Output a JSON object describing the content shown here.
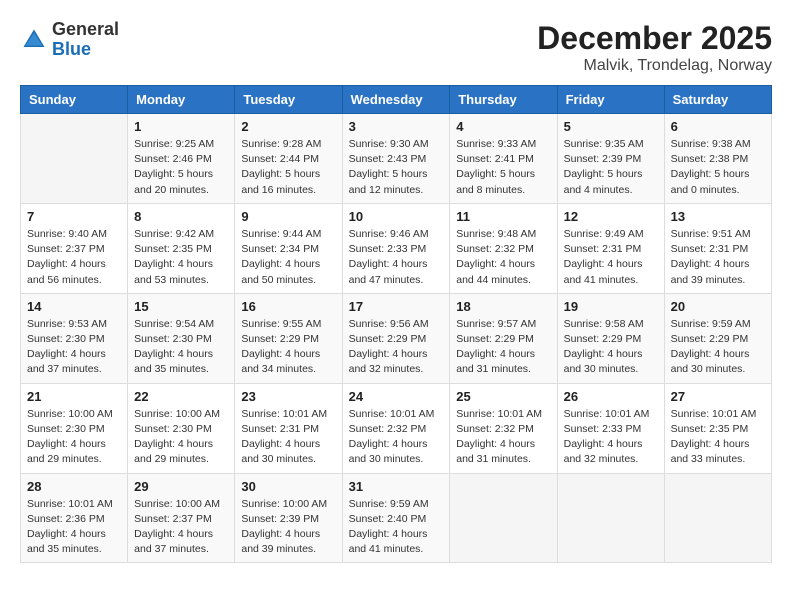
{
  "header": {
    "logo_general": "General",
    "logo_blue": "Blue",
    "month_year": "December 2025",
    "location": "Malvik, Trondelag, Norway"
  },
  "days_of_week": [
    "Sunday",
    "Monday",
    "Tuesday",
    "Wednesday",
    "Thursday",
    "Friday",
    "Saturday"
  ],
  "weeks": [
    [
      {
        "day": "",
        "info": ""
      },
      {
        "day": "1",
        "info": "Sunrise: 9:25 AM\nSunset: 2:46 PM\nDaylight: 5 hours\nand 20 minutes."
      },
      {
        "day": "2",
        "info": "Sunrise: 9:28 AM\nSunset: 2:44 PM\nDaylight: 5 hours\nand 16 minutes."
      },
      {
        "day": "3",
        "info": "Sunrise: 9:30 AM\nSunset: 2:43 PM\nDaylight: 5 hours\nand 12 minutes."
      },
      {
        "day": "4",
        "info": "Sunrise: 9:33 AM\nSunset: 2:41 PM\nDaylight: 5 hours\nand 8 minutes."
      },
      {
        "day": "5",
        "info": "Sunrise: 9:35 AM\nSunset: 2:39 PM\nDaylight: 5 hours\nand 4 minutes."
      },
      {
        "day": "6",
        "info": "Sunrise: 9:38 AM\nSunset: 2:38 PM\nDaylight: 5 hours\nand 0 minutes."
      }
    ],
    [
      {
        "day": "7",
        "info": "Sunrise: 9:40 AM\nSunset: 2:37 PM\nDaylight: 4 hours\nand 56 minutes."
      },
      {
        "day": "8",
        "info": "Sunrise: 9:42 AM\nSunset: 2:35 PM\nDaylight: 4 hours\nand 53 minutes."
      },
      {
        "day": "9",
        "info": "Sunrise: 9:44 AM\nSunset: 2:34 PM\nDaylight: 4 hours\nand 50 minutes."
      },
      {
        "day": "10",
        "info": "Sunrise: 9:46 AM\nSunset: 2:33 PM\nDaylight: 4 hours\nand 47 minutes."
      },
      {
        "day": "11",
        "info": "Sunrise: 9:48 AM\nSunset: 2:32 PM\nDaylight: 4 hours\nand 44 minutes."
      },
      {
        "day": "12",
        "info": "Sunrise: 9:49 AM\nSunset: 2:31 PM\nDaylight: 4 hours\nand 41 minutes."
      },
      {
        "day": "13",
        "info": "Sunrise: 9:51 AM\nSunset: 2:31 PM\nDaylight: 4 hours\nand 39 minutes."
      }
    ],
    [
      {
        "day": "14",
        "info": "Sunrise: 9:53 AM\nSunset: 2:30 PM\nDaylight: 4 hours\nand 37 minutes."
      },
      {
        "day": "15",
        "info": "Sunrise: 9:54 AM\nSunset: 2:30 PM\nDaylight: 4 hours\nand 35 minutes."
      },
      {
        "day": "16",
        "info": "Sunrise: 9:55 AM\nSunset: 2:29 PM\nDaylight: 4 hours\nand 34 minutes."
      },
      {
        "day": "17",
        "info": "Sunrise: 9:56 AM\nSunset: 2:29 PM\nDaylight: 4 hours\nand 32 minutes."
      },
      {
        "day": "18",
        "info": "Sunrise: 9:57 AM\nSunset: 2:29 PM\nDaylight: 4 hours\nand 31 minutes."
      },
      {
        "day": "19",
        "info": "Sunrise: 9:58 AM\nSunset: 2:29 PM\nDaylight: 4 hours\nand 30 minutes."
      },
      {
        "day": "20",
        "info": "Sunrise: 9:59 AM\nSunset: 2:29 PM\nDaylight: 4 hours\nand 30 minutes."
      }
    ],
    [
      {
        "day": "21",
        "info": "Sunrise: 10:00 AM\nSunset: 2:30 PM\nDaylight: 4 hours\nand 29 minutes."
      },
      {
        "day": "22",
        "info": "Sunrise: 10:00 AM\nSunset: 2:30 PM\nDaylight: 4 hours\nand 29 minutes."
      },
      {
        "day": "23",
        "info": "Sunrise: 10:01 AM\nSunset: 2:31 PM\nDaylight: 4 hours\nand 30 minutes."
      },
      {
        "day": "24",
        "info": "Sunrise: 10:01 AM\nSunset: 2:32 PM\nDaylight: 4 hours\nand 30 minutes."
      },
      {
        "day": "25",
        "info": "Sunrise: 10:01 AM\nSunset: 2:32 PM\nDaylight: 4 hours\nand 31 minutes."
      },
      {
        "day": "26",
        "info": "Sunrise: 10:01 AM\nSunset: 2:33 PM\nDaylight: 4 hours\nand 32 minutes."
      },
      {
        "day": "27",
        "info": "Sunrise: 10:01 AM\nSunset: 2:35 PM\nDaylight: 4 hours\nand 33 minutes."
      }
    ],
    [
      {
        "day": "28",
        "info": "Sunrise: 10:01 AM\nSunset: 2:36 PM\nDaylight: 4 hours\nand 35 minutes."
      },
      {
        "day": "29",
        "info": "Sunrise: 10:00 AM\nSunset: 2:37 PM\nDaylight: 4 hours\nand 37 minutes."
      },
      {
        "day": "30",
        "info": "Sunrise: 10:00 AM\nSunset: 2:39 PM\nDaylight: 4 hours\nand 39 minutes."
      },
      {
        "day": "31",
        "info": "Sunrise: 9:59 AM\nSunset: 2:40 PM\nDaylight: 4 hours\nand 41 minutes."
      },
      {
        "day": "",
        "info": ""
      },
      {
        "day": "",
        "info": ""
      },
      {
        "day": "",
        "info": ""
      }
    ]
  ]
}
